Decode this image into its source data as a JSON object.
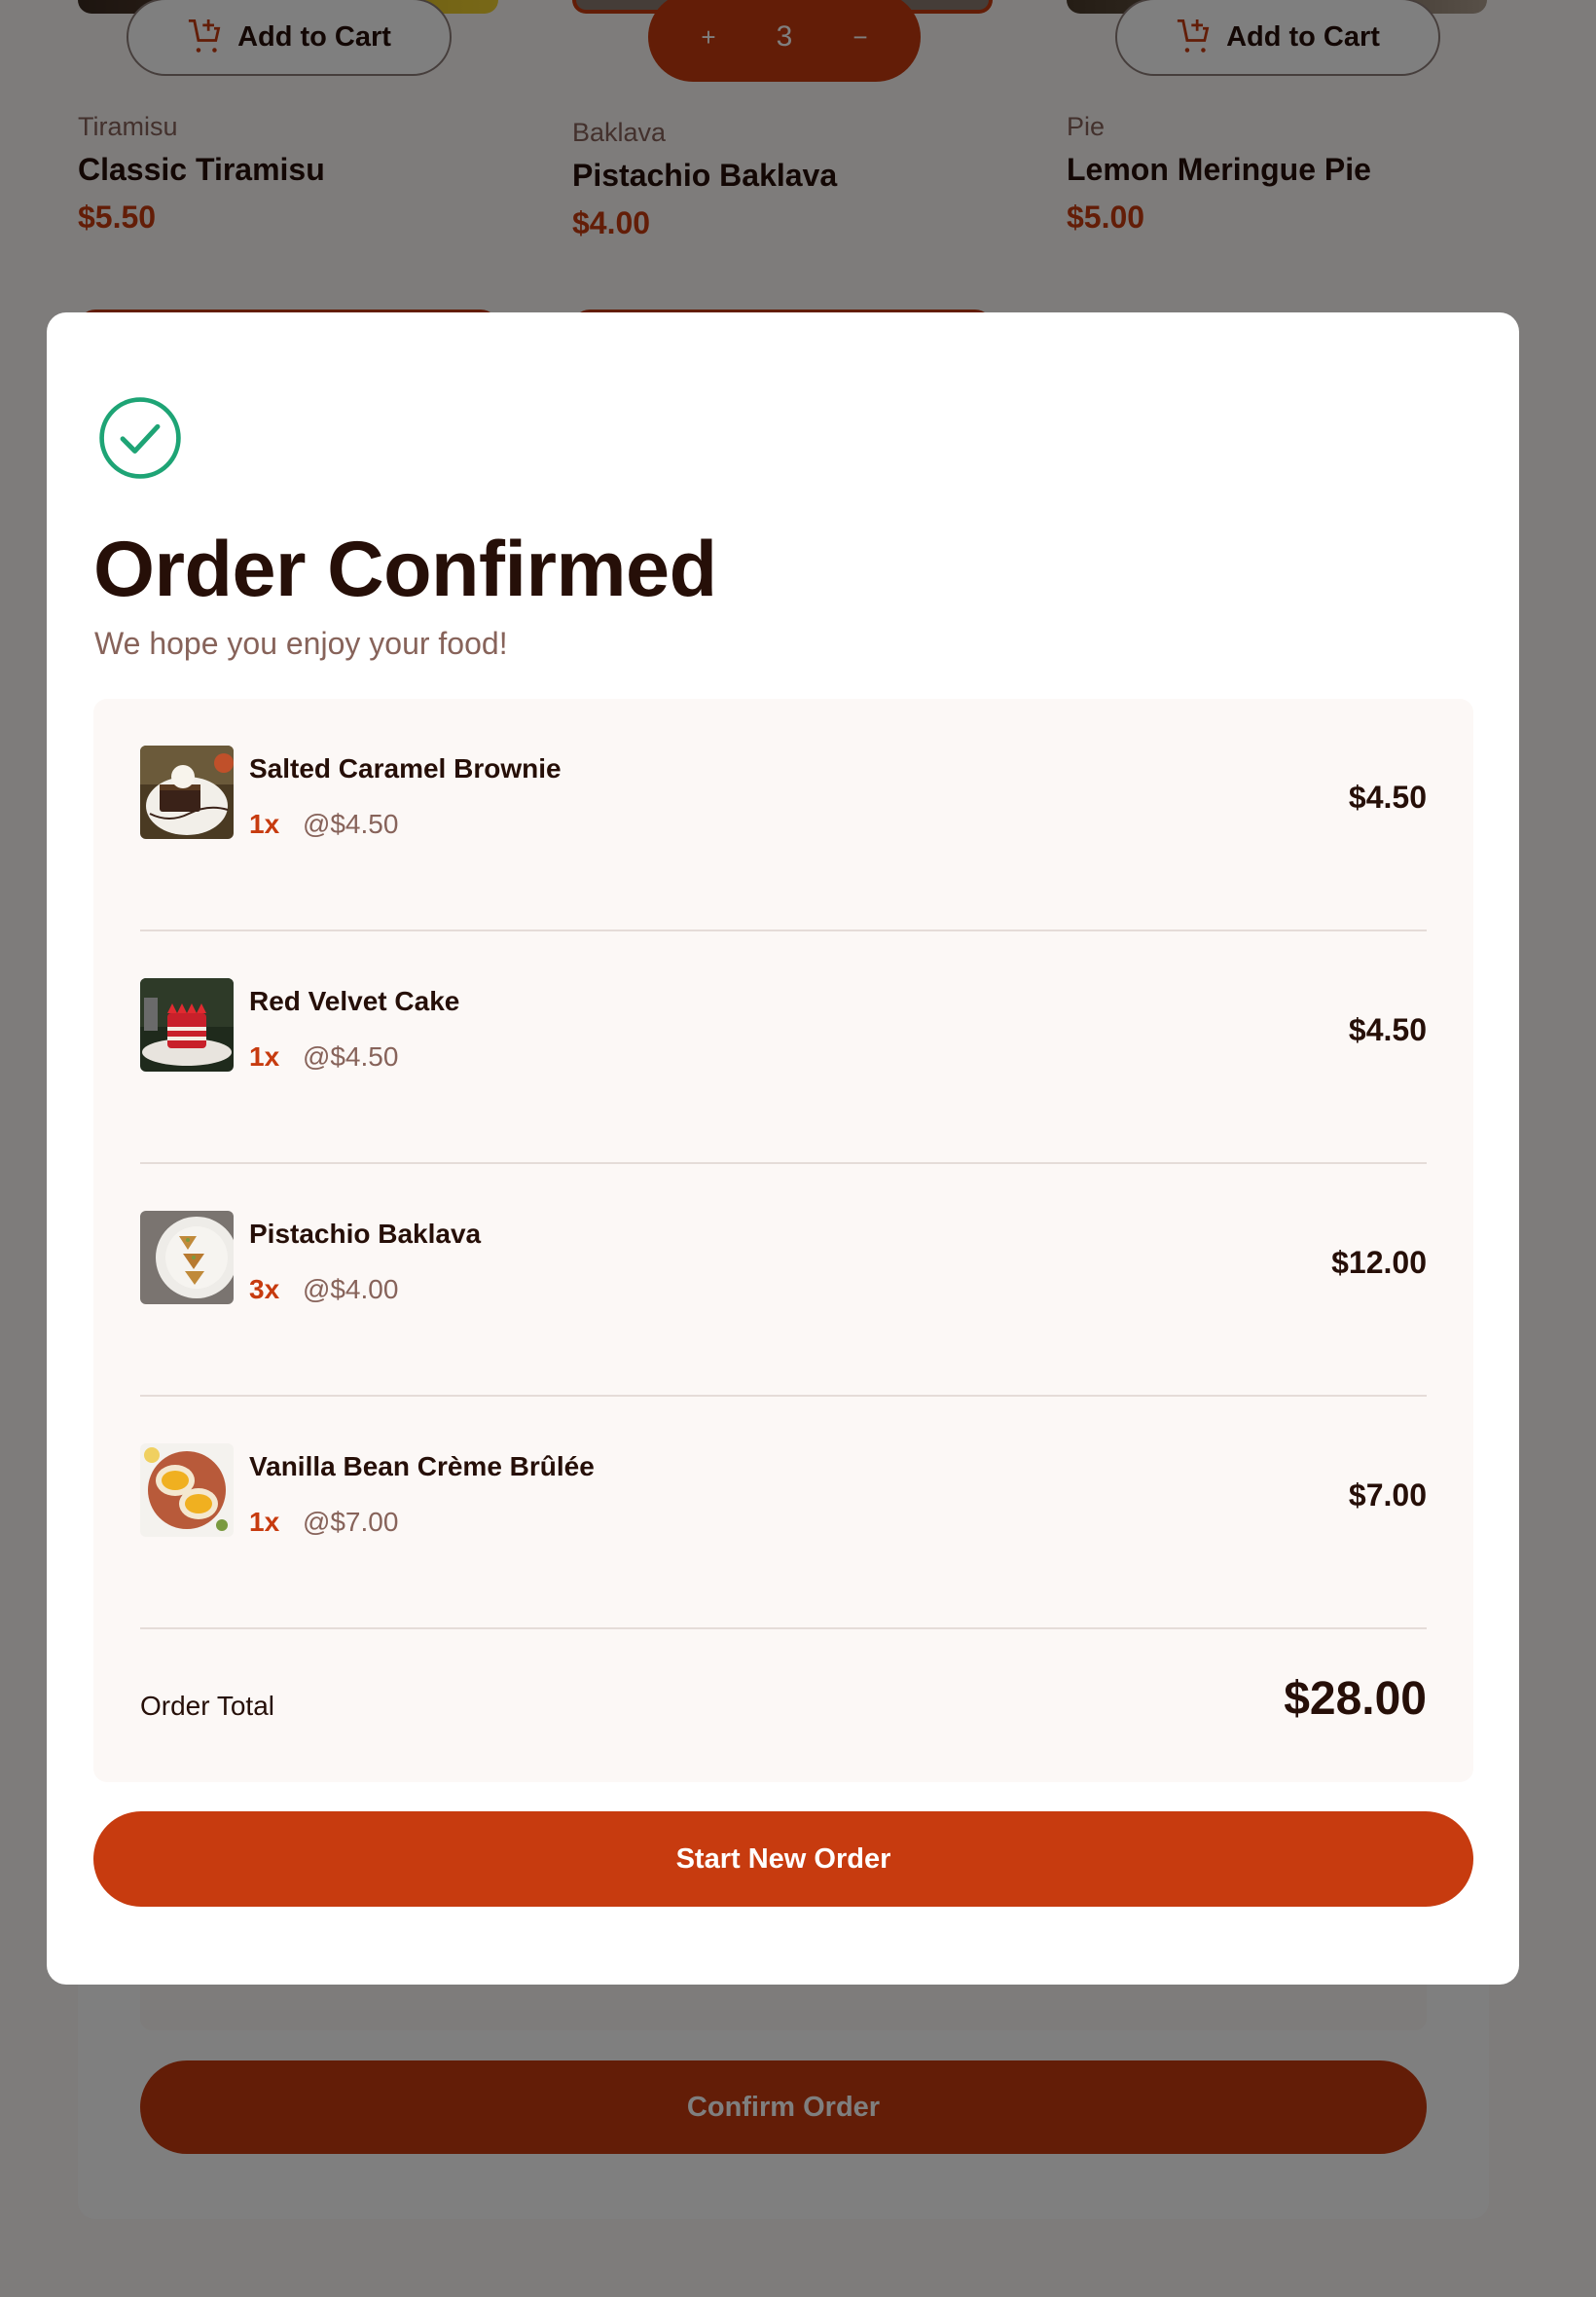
{
  "products": [
    {
      "category": "Tiramisu",
      "name": "Classic Tiramisu",
      "price": "$5.50",
      "button_label": "Add to Cart"
    },
    {
      "category": "Baklava",
      "name": "Pistachio Baklava",
      "price": "$4.00",
      "quantity": "3",
      "increment_icon": "plus-icon",
      "decrement_icon": "minus-icon"
    },
    {
      "category": "Pie",
      "name": "Lemon Meringue Pie",
      "price": "$5.00",
      "button_label": "Add to Cart"
    }
  ],
  "cart": {
    "confirm_label": "Confirm Order"
  },
  "modal": {
    "icon": "check-circle-icon",
    "title": "Order Confirmed",
    "subtitle": "We hope you enjoy your food!",
    "items": [
      {
        "name": "Salted Caramel Brownie",
        "qty": "1x",
        "unit_price": "@$4.50",
        "total": "$4.50"
      },
      {
        "name": "Red Velvet Cake",
        "qty": "1x",
        "unit_price": "@$4.50",
        "total": "$4.50"
      },
      {
        "name": "Pistachio Baklava",
        "qty": "3x",
        "unit_price": "@$4.00",
        "total": "$12.00"
      },
      {
        "name": "Vanilla Bean Crème Brûlée",
        "qty": "1x",
        "unit_price": "@$7.00",
        "total": "$7.00"
      }
    ],
    "total_label": "Order Total",
    "total_value": "$28.00",
    "button_label": "Start New Order"
  },
  "colors": {
    "accent": "#c73b0f",
    "success": "#1ea475",
    "text_dark": "#260f08",
    "text_muted": "#87635a",
    "panel_bg": "#fcf8f6"
  }
}
